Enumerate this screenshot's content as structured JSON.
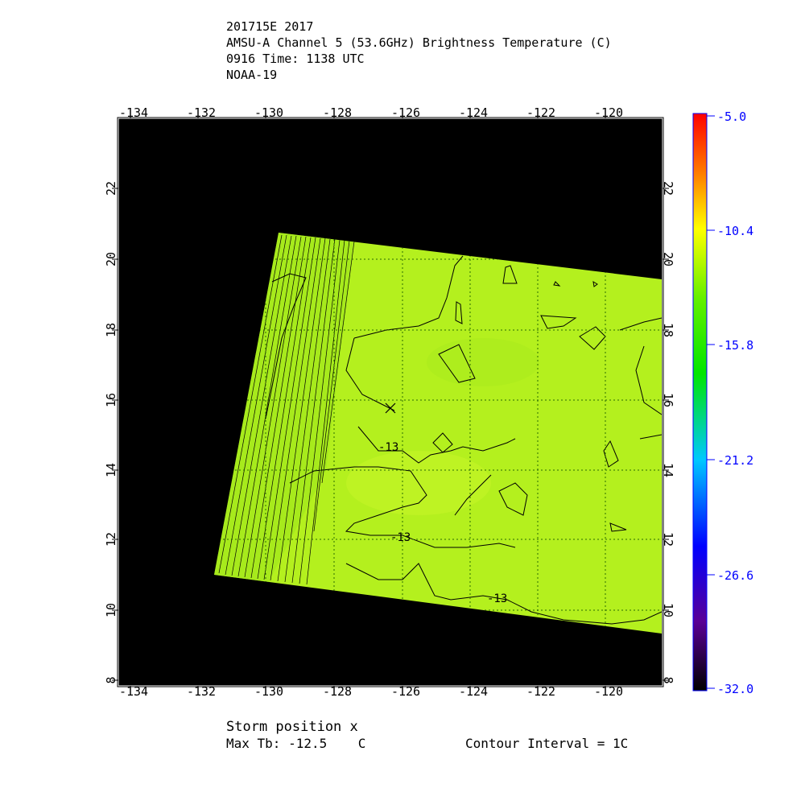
{
  "header": {
    "line1": "201715E 2017",
    "line2": "AMSU-A Channel 5 (53.6GHz) Brightness Temperature (C)",
    "line3": "0916 Time: 1138 UTC",
    "line4": "NOAA-19"
  },
  "map": {
    "lon_labels": [
      "-134",
      "-132",
      "-130",
      "-128",
      "-126",
      "-124",
      "-122",
      "-120"
    ],
    "lat_labels": [
      "8",
      "10",
      "12",
      "14",
      "16",
      "18",
      "20",
      "22"
    ],
    "contour_labels": [
      "-13",
      "-13",
      "-13"
    ],
    "storm_marker": "x",
    "colors": {
      "background": "#000000",
      "field": "#b4f01e",
      "grid": "#2a6b00",
      "contour": "#000000"
    }
  },
  "colorbar": {
    "tick_labels": [
      "-5.0",
      "-10.4",
      "-15.8",
      "-21.2",
      "-26.6",
      "-32.0"
    ],
    "label_color": "#0000ff"
  },
  "footer": {
    "storm_position": "Storm position x",
    "max_tb": "Max Tb: -12.5    C",
    "contour_interval": "Contour Interval = 1C"
  }
}
